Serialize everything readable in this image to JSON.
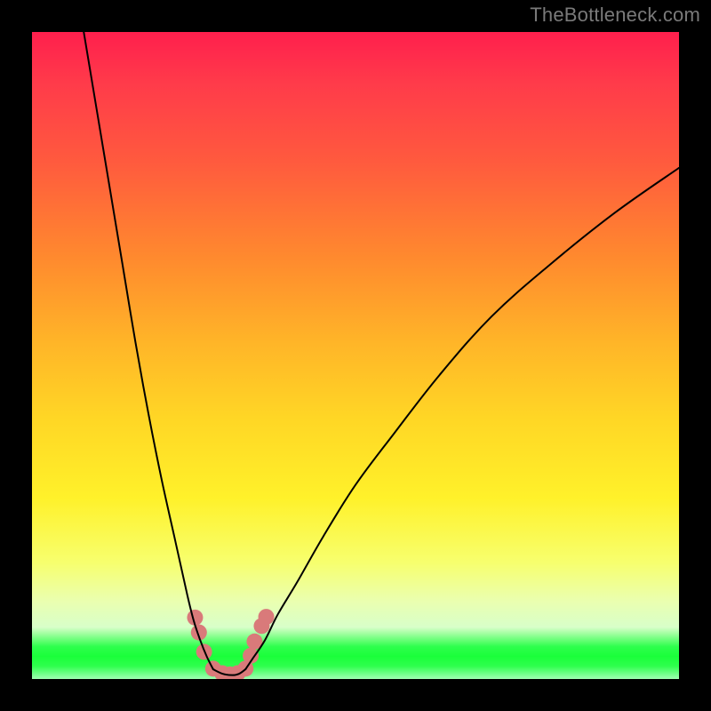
{
  "watermark": {
    "text": "TheBottleneck.com"
  },
  "chart_data": {
    "type": "line",
    "title": "",
    "xlabel": "",
    "ylabel": "",
    "xlim": [
      0,
      100
    ],
    "ylim": [
      0,
      100
    ],
    "grid": false,
    "series": [
      {
        "name": "left-branch",
        "x": [
          8,
          10,
          12,
          14,
          16,
          18,
          20,
          22,
          24,
          25,
          26,
          27,
          28
        ],
        "y": [
          100,
          88,
          76,
          64,
          52,
          41,
          31,
          22,
          13,
          9,
          6,
          3.5,
          1.5
        ],
        "stroke": "#000000"
      },
      {
        "name": "right-branch",
        "x": [
          33,
          34,
          36,
          38,
          41,
          45,
          50,
          56,
          63,
          71,
          80,
          90,
          100
        ],
        "y": [
          1.5,
          3,
          6,
          10,
          15,
          22,
          30,
          38,
          47,
          56,
          64,
          72,
          79
        ],
        "stroke": "#000000"
      },
      {
        "name": "valley-link",
        "x": [
          28,
          29.5,
          31,
          32,
          33
        ],
        "y": [
          1.5,
          0.8,
          0.6,
          0.8,
          1.5
        ],
        "stroke": "#000000"
      },
      {
        "name": "marker-dots",
        "type": "scatter",
        "color": "#d97a7a",
        "points": [
          {
            "x": 25.2,
            "y": 9.5
          },
          {
            "x": 25.8,
            "y": 7.2
          },
          {
            "x": 26.6,
            "y": 4.2
          },
          {
            "x": 28.0,
            "y": 1.6
          },
          {
            "x": 29.4,
            "y": 0.9
          },
          {
            "x": 30.6,
            "y": 0.7
          },
          {
            "x": 31.8,
            "y": 0.9
          },
          {
            "x": 33.0,
            "y": 1.6
          },
          {
            "x": 33.8,
            "y": 3.6
          },
          {
            "x": 34.4,
            "y": 5.8
          },
          {
            "x": 35.5,
            "y": 8.2
          },
          {
            "x": 36.2,
            "y": 9.6
          }
        ]
      }
    ]
  }
}
